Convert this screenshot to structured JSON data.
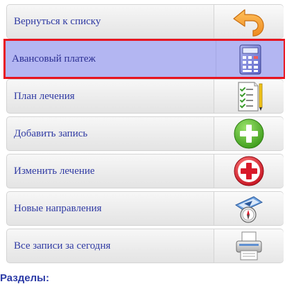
{
  "menu": {
    "items": [
      {
        "label": "Вернуться к списку",
        "icon": "back-arrow-icon",
        "selected": false
      },
      {
        "label": "Авансовый платеж",
        "icon": "calculator-icon",
        "selected": true
      },
      {
        "label": "План лечения",
        "icon": "checklist-icon",
        "selected": false
      },
      {
        "label": "Добавить запись",
        "icon": "plus-icon",
        "selected": false
      },
      {
        "label": "Изменить лечение",
        "icon": "red-plus-icon",
        "selected": false
      },
      {
        "label": "Новые направления",
        "icon": "compass-icon",
        "selected": false
      },
      {
        "label": "Все записи за сегодня",
        "icon": "printer-icon",
        "selected": false
      }
    ]
  },
  "sections": {
    "title": "Разделы:"
  },
  "colors": {
    "link_text": "#2f3aa3",
    "selected_bg": "#b3b6f2",
    "selected_border": "#e8141f",
    "accent_orange": "#f39a2c",
    "accent_green": "#5cb82e",
    "accent_red": "#d8192a"
  }
}
